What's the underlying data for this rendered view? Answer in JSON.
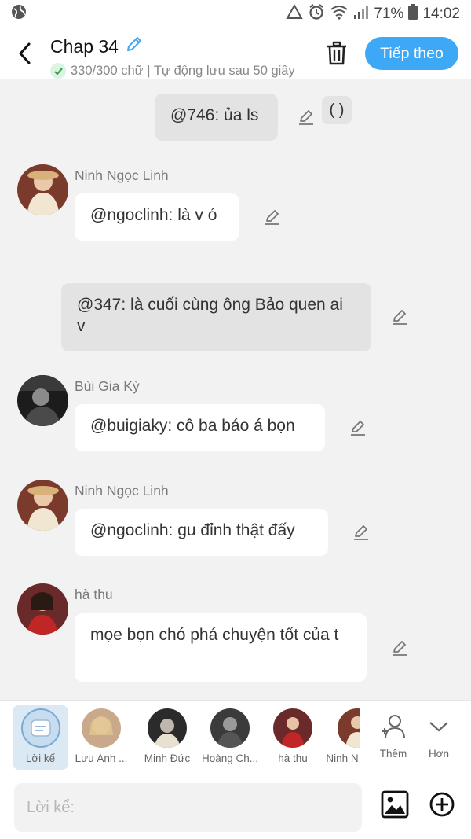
{
  "status_bar": {
    "battery": "71%",
    "time": "14:02"
  },
  "header": {
    "title": "Chap 34",
    "subtitle": "330/300 chữ | Tự động lưu sau 50 giây",
    "next_label": "Tiếp theo"
  },
  "messages": [
    {
      "kind": "narration",
      "text": "@746: ủa ls"
    },
    {
      "kind": "character",
      "name": "Ninh Ngọc Linh",
      "text": "@ngoclinh: là v ó"
    },
    {
      "kind": "narration",
      "text": "@347: là cuối cùng ông Bảo quen ai v"
    },
    {
      "kind": "character",
      "name": "Bùi Gia Kỳ",
      "text": "@buigiaky: cô ba báo á bọn"
    },
    {
      "kind": "character",
      "name": "Ninh Ngọc Linh",
      "text": "@ngoclinh: gu đỉnh thật đấy"
    },
    {
      "kind": "character",
      "name": "hà thu",
      "text": "mọe bọn chó phá chuyện tốt của t"
    }
  ],
  "characters": [
    {
      "label": "Lời kể"
    },
    {
      "label": "Lưu Ánh ..."
    },
    {
      "label": "Minh Đức"
    },
    {
      "label": "Hoàng Ch..."
    },
    {
      "label": "hà thu"
    },
    {
      "label": "Ninh N"
    }
  ],
  "add_label": "Thêm",
  "more_label": "Hơn",
  "composer": {
    "placeholder": "Lời kể:",
    "paren_label": "( )"
  },
  "colors": {
    "accent": "#3da8f5",
    "narration_bg": "#e3e3e3",
    "bubble_bg": "#ffffff"
  }
}
